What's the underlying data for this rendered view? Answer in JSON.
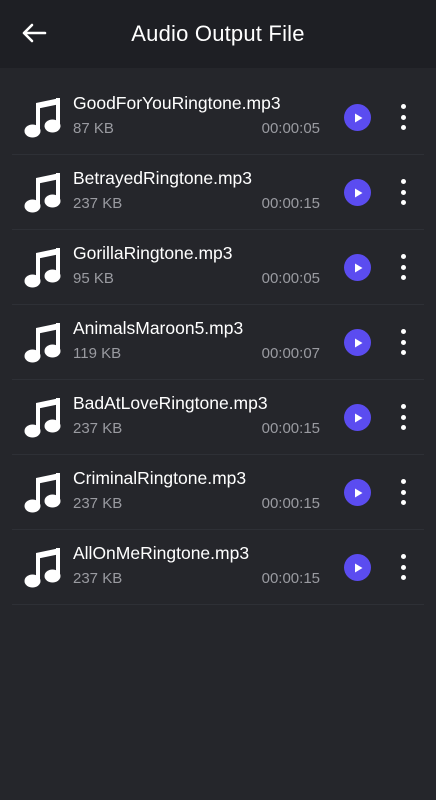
{
  "header": {
    "title": "Audio Output File",
    "back_icon": "arrow-left-icon"
  },
  "colors": {
    "background": "#25262b",
    "app_bar": "#1e1f24",
    "accent": "#5b4cf0",
    "secondary_text": "#9a9ba1"
  },
  "files": [
    {
      "name": "GoodForYouRingtone.mp3",
      "size": "87 KB",
      "duration": "00:00:05",
      "icon": "music-note-icon"
    },
    {
      "name": "BetrayedRingtone.mp3",
      "size": "237 KB",
      "duration": "00:00:15",
      "icon": "music-note-icon"
    },
    {
      "name": "GorillaRingtone.mp3",
      "size": "95 KB",
      "duration": "00:00:05",
      "icon": "music-note-icon"
    },
    {
      "name": "AnimalsMaroon5.mp3",
      "size": "119 KB",
      "duration": "00:00:07",
      "icon": "music-note-icon"
    },
    {
      "name": "BadAtLoveRingtone.mp3",
      "size": "237 KB",
      "duration": "00:00:15",
      "icon": "music-note-icon"
    },
    {
      "name": "CriminalRingtone.mp3",
      "size": "237 KB",
      "duration": "00:00:15",
      "icon": "music-note-icon"
    },
    {
      "name": "AllOnMeRingtone.mp3",
      "size": "237 KB",
      "duration": "00:00:15",
      "icon": "music-note-icon"
    }
  ]
}
